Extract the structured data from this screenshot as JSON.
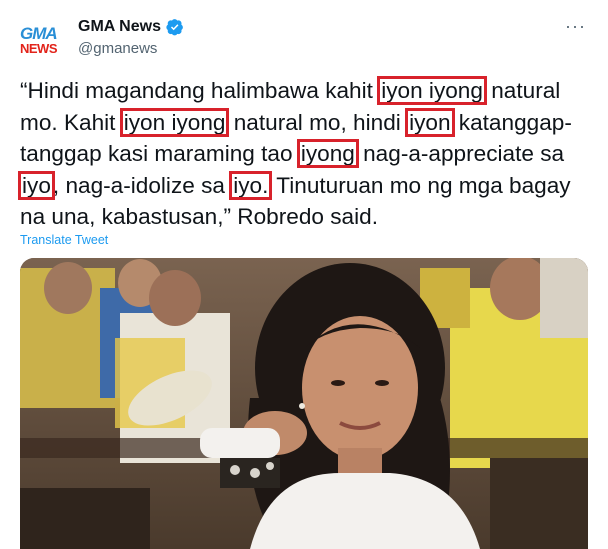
{
  "account": {
    "logo_top": "GMA",
    "logo_bottom": "NEWS",
    "display_name": "GMA News",
    "handle": "@gmanews",
    "more_label": "···"
  },
  "tweet": {
    "lines": [
      [
        {
          "t": "“Hindi magandang halimbawa kahit ",
          "hl": false
        },
        {
          "t": "iyon iyong",
          "hl": true
        },
        {
          "t": " natural",
          "hl": false
        }
      ],
      [
        {
          "t": "mo. Kahit ",
          "hl": false
        },
        {
          "t": "iyon iyong",
          "hl": true
        },
        {
          "t": " natural mo, hindi ",
          "hl": false
        },
        {
          "t": "iyon",
          "hl": true
        },
        {
          "t": " katanggap-",
          "hl": false
        }
      ],
      [
        {
          "t": "tanggap kasi maraming tao ",
          "hl": false
        },
        {
          "t": "iyong",
          "hl": true
        },
        {
          "t": " nag-a-appreciate sa",
          "hl": false
        }
      ],
      [
        {
          "t": "iyo",
          "hl": true
        },
        {
          "t": ", nag-a-idolize sa ",
          "hl": false
        },
        {
          "t": "iyo.",
          "hl": true
        },
        {
          "t": " Tinuturuan mo ng mga bagay",
          "hl": false
        }
      ],
      [
        {
          "t": "na una, kabastusan,” Robredo said.",
          "hl": false
        }
      ]
    ],
    "translate_label": "Translate Tweet"
  },
  "colors": {
    "highlight": "#d8222b",
    "link": "#1d9bf0",
    "verified": "#1d9bf0"
  },
  "photo": {
    "subject": "woman with dark hair seated among people in yellow shirts"
  }
}
